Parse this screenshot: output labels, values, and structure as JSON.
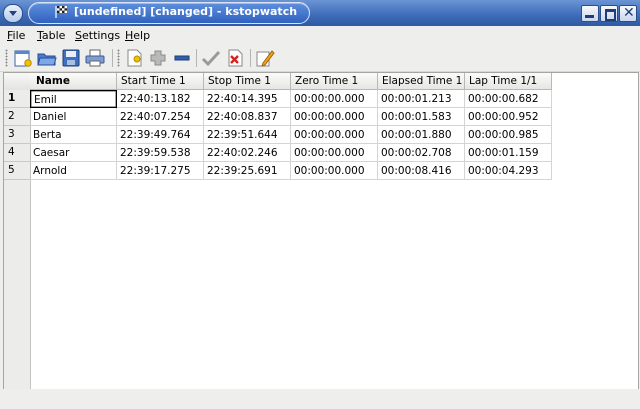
{
  "window": {
    "title": "[undefined] [changed] - kstopwatch",
    "icon": "checkered-flag-icon"
  },
  "menu": [
    {
      "label_ul": "F",
      "label_rest": "ile"
    },
    {
      "label_ul": "T",
      "label_rest": "able"
    },
    {
      "label_ul": "S",
      "label_rest": "ettings"
    },
    {
      "label_ul": "H",
      "label_rest": "elp"
    }
  ],
  "toolbar": {
    "buttons": [
      "new-file-icon",
      "open-folder-icon",
      "save-icon",
      "print-icon",
      "new-row-icon",
      "add-icon",
      "remove-icon",
      "check-icon",
      "delete-icon",
      "edit-icon"
    ]
  },
  "table": {
    "columns": [
      "Name",
      "Start Time 1",
      "Stop Time 1",
      "Zero Time 1",
      "Elapsed Time 1",
      "Lap Time 1/1"
    ],
    "rows": [
      {
        "num": "1",
        "cells": [
          "Emil",
          "22:40:13.182",
          "22:40:14.395",
          "00:00:00.000",
          "00:00:01.213",
          "00:00:00.682"
        ]
      },
      {
        "num": "2",
        "cells": [
          "Daniel",
          "22:40:07.254",
          "22:40:08.837",
          "00:00:00.000",
          "00:00:01.583",
          "00:00:00.952"
        ]
      },
      {
        "num": "3",
        "cells": [
          "Berta",
          "22:39:49.764",
          "22:39:51.644",
          "00:00:00.000",
          "00:00:01.880",
          "00:00:00.985"
        ]
      },
      {
        "num": "4",
        "cells": [
          "Caesar",
          "22:39:59.538",
          "22:40:02.246",
          "00:00:00.000",
          "00:00:02.708",
          "00:00:01.159"
        ]
      },
      {
        "num": "5",
        "cells": [
          "Arnold",
          "22:39:17.275",
          "22:39:25.691",
          "00:00:00.000",
          "00:00:08.416",
          "00:00:04.293"
        ]
      }
    ]
  },
  "colors": {
    "titlebar": "#3d6bb8",
    "background": "#eeeeec"
  }
}
